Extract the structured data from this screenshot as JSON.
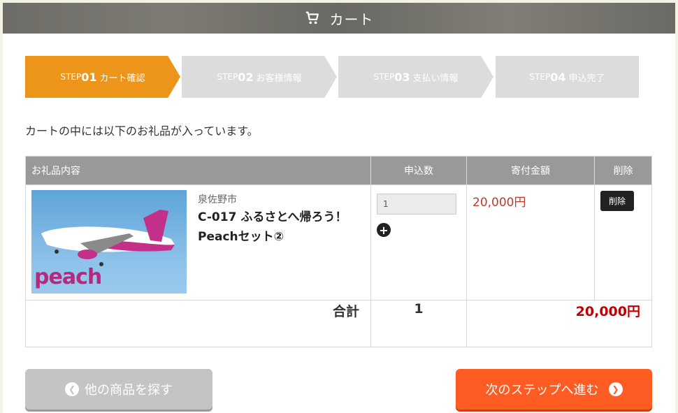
{
  "header": {
    "title": "カート",
    "icon": "cart-icon"
  },
  "steps": [
    {
      "prefix": "STEP",
      "num": "01",
      "label": "カート確認",
      "active": true
    },
    {
      "prefix": "STEP",
      "num": "02",
      "label": "お客様情報",
      "active": false
    },
    {
      "prefix": "STEP",
      "num": "03",
      "label": "支払い情報",
      "active": false
    },
    {
      "prefix": "STEP",
      "num": "04",
      "label": "申込完了",
      "active": false
    }
  ],
  "intro": "カートの中には以下のお礼品が入っています。",
  "table": {
    "headers": {
      "item": "お礼品内容",
      "qty": "申込数",
      "amount": "寄付金額",
      "delete": "削除"
    },
    "item": {
      "city": "泉佐野市",
      "name": "C-017 ふるさとへ帰ろう！Peachセット②",
      "image_logo": "peach",
      "qty_value": "1",
      "amount": "20,000円",
      "delete_label": "削除"
    },
    "total": {
      "label": "合計",
      "qty": "1",
      "amount": "20,000円"
    }
  },
  "buttons": {
    "back": "他の商品を探す",
    "next": "次のステップへ進む"
  },
  "colors": {
    "active_step": "#ec951a",
    "inactive_step": "#dcdcdc",
    "next_button": "#ff5c24",
    "price": "#c00000"
  }
}
